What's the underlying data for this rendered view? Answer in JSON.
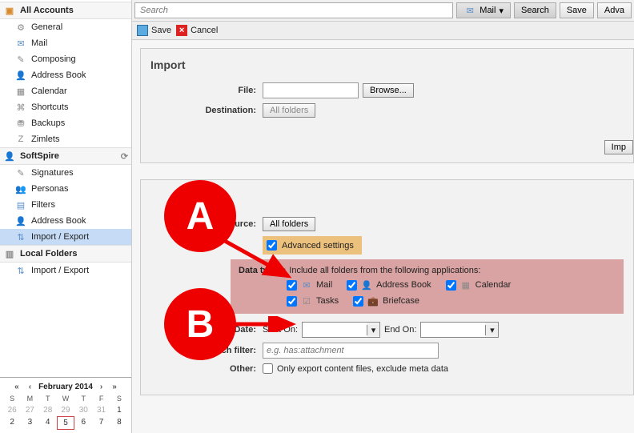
{
  "topbar": {
    "search_placeholder": "Search",
    "mail_btn": "Mail",
    "search_btn": "Search",
    "save_btn": "Save",
    "adv_btn": "Adva"
  },
  "subbar": {
    "save_label": "Save",
    "cancel_label": "Cancel"
  },
  "tree": {
    "all_accounts": "All Accounts",
    "items1": [
      "General",
      "Mail",
      "Composing",
      "Address Book",
      "Calendar",
      "Shortcuts",
      "Backups",
      "Zimlets"
    ],
    "account2": "SoftSpire",
    "items2": [
      "Signatures",
      "Personas",
      "Filters",
      "Address Book",
      "Import / Export"
    ],
    "local_folders": "Local Folders",
    "items3": [
      "Import / Export"
    ]
  },
  "calendar": {
    "title": "February 2014",
    "dow": [
      "S",
      "M",
      "T",
      "W",
      "T",
      "F",
      "S"
    ],
    "rows": [
      [
        "26",
        "27",
        "28",
        "29",
        "30",
        "31",
        "1"
      ],
      [
        "2",
        "3",
        "4",
        "5",
        "6",
        "7",
        "8"
      ]
    ],
    "selected": "5"
  },
  "import_panel": {
    "title": "Import",
    "file_label": "File:",
    "browse_btn": "Browse...",
    "destination_label": "Destination:",
    "destination_btn": "All folders",
    "import_btn": "Imp"
  },
  "export_panel": {
    "source_label": "Source:",
    "source_btn": "All folders",
    "advanced_label": "Advanced settings",
    "datatypes_label": "Data types:",
    "datatypes_desc": "Include all folders from the following applications:",
    "types": {
      "mail": "Mail",
      "addressbook": "Address Book",
      "calendar": "Calendar",
      "tasks": "Tasks",
      "briefcase": "Briefcase"
    },
    "date_label": "Date:",
    "start_on": "Start On:",
    "end_on": "End On:",
    "filter_label": "Search filter:",
    "filter_placeholder": "e.g. has:attachment",
    "other_label": "Other:",
    "other_check": "Only export content files, exclude meta data"
  },
  "badges": {
    "a": "A",
    "b": "B"
  }
}
